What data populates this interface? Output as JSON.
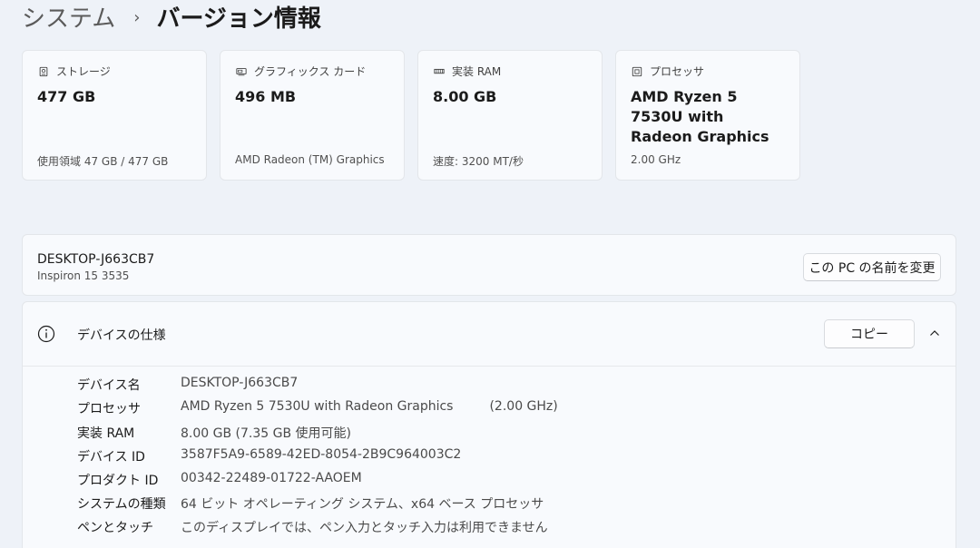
{
  "breadcrumb": {
    "parent": "システム",
    "separator": "›",
    "current": "バージョン情報"
  },
  "cards": [
    {
      "icon": "storage-icon",
      "title": "ストレージ",
      "value": "477 GB",
      "detail": "使用領域 47 GB / 477 GB"
    },
    {
      "icon": "graphics-card-icon",
      "title": "グラフィックス カード",
      "value": "496 MB",
      "detail": "AMD Radeon (TM) Graphics"
    },
    {
      "icon": "ram-icon",
      "title": "実装 RAM",
      "value": "8.00 GB",
      "detail": "速度: 3200 MT/秒"
    },
    {
      "icon": "processor-icon",
      "title": "プロセッサ",
      "value": "AMD Ryzen 5 7530U with Radeon Graphics",
      "detail": "2.00 GHz"
    }
  ],
  "device": {
    "name": "DESKTOP-J663CB7",
    "model": "Inspiron 15 3535",
    "rename_label": "この PC の名前を変更"
  },
  "specs": {
    "title": "デバイスの仕様",
    "copy_label": "コピー",
    "rows": [
      {
        "label": "デバイス名",
        "value": "DESKTOP-J663CB7",
        "extra": ""
      },
      {
        "label": "プロセッサ",
        "value": "AMD Ryzen 5 7530U with Radeon Graphics",
        "extra": "(2.00 GHz)"
      },
      {
        "label": "実装 RAM",
        "value": "8.00 GB (7.35 GB 使用可能)",
        "extra": ""
      },
      {
        "label": "デバイス ID",
        "value": "3587F5A9-6589-42ED-8054-2B9C964003C2",
        "extra": ""
      },
      {
        "label": "プロダクト ID",
        "value": "00342-22489-01722-AAOEM",
        "extra": ""
      },
      {
        "label": "システムの種類",
        "value": "64 ビット オペレーティング システム、x64 ベース プロセッサ",
        "extra": ""
      },
      {
        "label": "ペンとタッチ",
        "value": "このディスプレイでは、ペン入力とタッチ入力は利用できません",
        "extra": ""
      }
    ]
  }
}
